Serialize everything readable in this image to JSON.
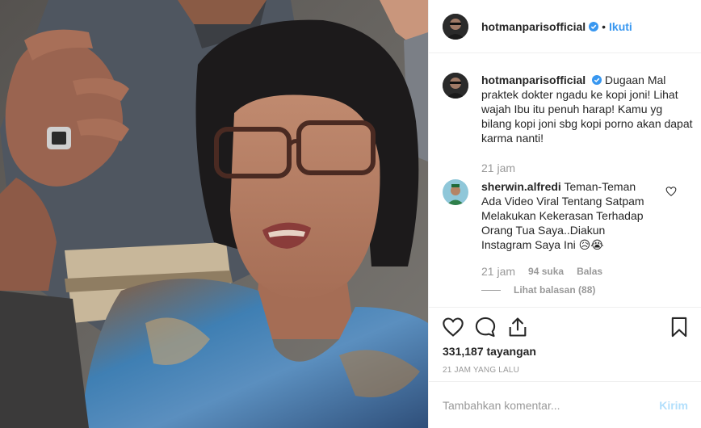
{
  "post": {
    "username": "hotmanparisofficial",
    "follow_label": "Ikuti",
    "dot": "•"
  },
  "caption": {
    "username": "hotmanparisofficial",
    "text": "Dugaan Mal praktek dokter ngadu ke kopi joni! Lihat wajah Ibu itu penuh harap! Kamu yg bilang kopi joni sbg kopi porno akan dapat karma nanti!",
    "time": "21 jam"
  },
  "comment": {
    "username": "sherwin.alfredi",
    "text": "Teman-Teman Ada Video Viral Tentang Satpam Melakukan Kekerasan Terhadap Orang Tua Saya..Diakun Instagram Saya Ini 😥😭",
    "time": "21 jam",
    "likes": "94 suka",
    "reply_label": "Balas",
    "view_replies": "Lihat balasan (88)"
  },
  "stats": {
    "views": "331,187 tayangan",
    "ago": "21 JAM YANG LALU"
  },
  "add_comment": {
    "placeholder": "Tambahkan komentar...",
    "send_label": "Kirim"
  },
  "colors": {
    "accent": "#3897f0",
    "send_disabled": "#b2dffc",
    "muted": "#999999"
  }
}
